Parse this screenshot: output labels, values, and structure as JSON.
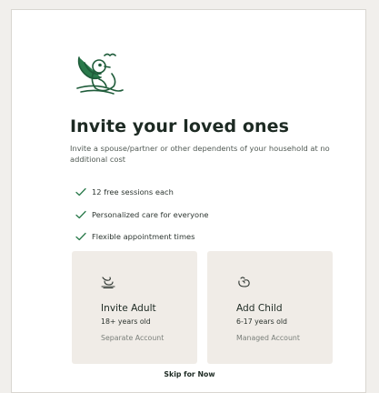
{
  "title": "Invite your loved ones",
  "subtitle": "Invite a spouse/partner or other dependents of your household at no additional cost",
  "features": [
    "12 free sessions each",
    "Personalized care for everyone",
    "Flexible appointment times"
  ],
  "options": {
    "adult": {
      "title": "Invite Adult",
      "age": "18+ years old",
      "account": "Separate Account",
      "icon": "adult-icon"
    },
    "child": {
      "title": "Add Child",
      "age": "6-17 years old",
      "account": "Managed Account",
      "icon": "child-icon"
    }
  },
  "skip_label": "Skip for Now",
  "colors": {
    "accent": "#2a7a4b",
    "tile": "#f0ece7",
    "background": "#f1efec"
  }
}
